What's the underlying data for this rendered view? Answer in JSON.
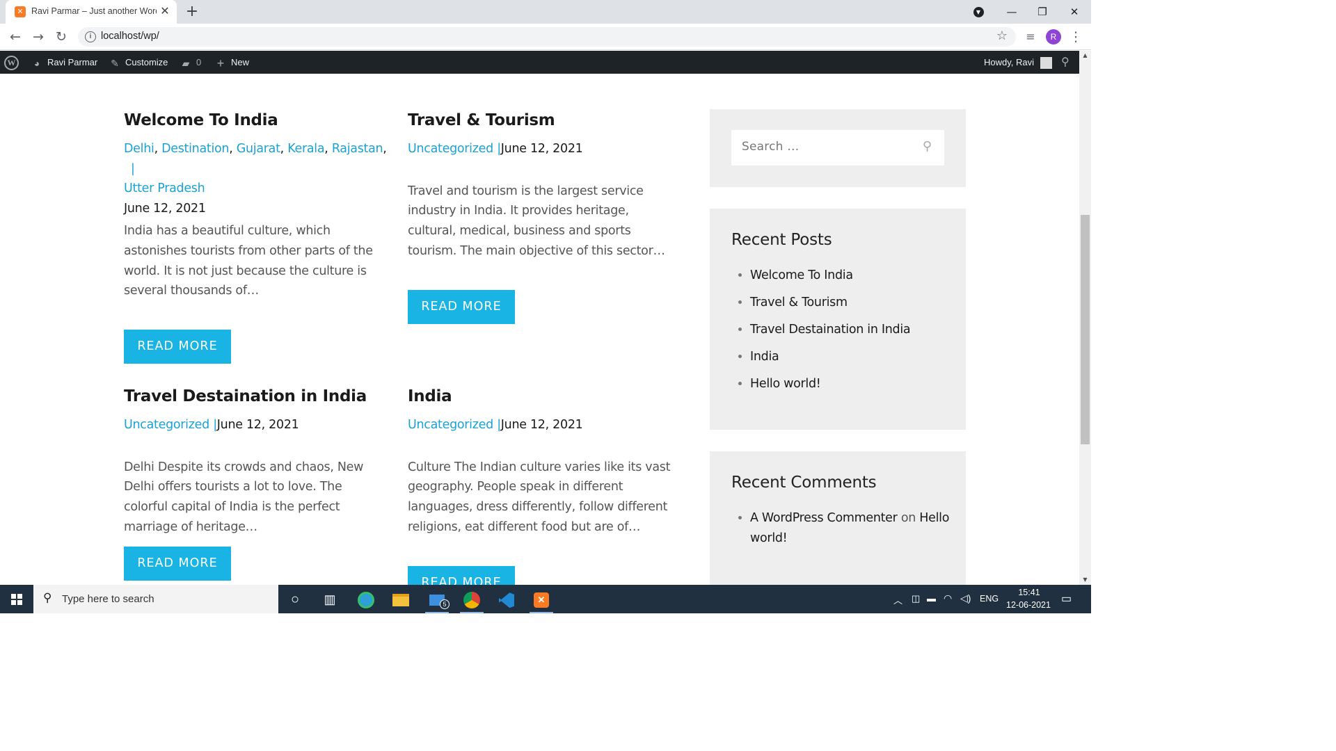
{
  "browser": {
    "tab_title": "Ravi Parmar – Just another Word",
    "tab_favicon_icon": "xampp-icon",
    "url": "localhost/wp/",
    "profile_initial": "R"
  },
  "admin_bar": {
    "site_name": "Ravi Parmar",
    "customize": "Customize",
    "comments_count": "0",
    "new": "New",
    "howdy": "Howdy, Ravi"
  },
  "posts": [
    {
      "title": "Welcome To India",
      "categories": [
        "Delhi",
        "Destination",
        "Gujarat",
        "Kerala",
        "Rajastan",
        "Utter Pradesh"
      ],
      "date": "June 12, 2021",
      "excerpt": "India has a beautiful culture, which astonishes tourists from other parts of the world. It is not just because the culture is several thousands of…",
      "button": "READ MORE"
    },
    {
      "title": "Travel & Tourism",
      "categories": [
        "Uncategorized"
      ],
      "date": "June 12, 2021",
      "excerpt": "Travel and tourism is the largest service industry in India. It provides heritage, cultural, medical, business and sports tourism. The main objective of this sector…",
      "button": "READ MORE"
    },
    {
      "title": "Travel Destaination in India",
      "categories": [
        "Uncategorized"
      ],
      "date": "June 12, 2021",
      "excerpt": "Delhi Despite its crowds and chaos, New Delhi offers tourists a lot to love. The colorful capital of India is the perfect marriage of heritage…",
      "button": "READ MORE"
    },
    {
      "title": "India",
      "categories": [
        "Uncategorized"
      ],
      "date": "June 12, 2021",
      "excerpt": "Culture The Indian culture varies like its vast geography. People speak in different languages, dress differently, follow different religions, eat different food but are of…",
      "button": "READ MORE"
    }
  ],
  "sidebar": {
    "search_placeholder": "Search …",
    "recent_posts_title": "Recent Posts",
    "recent_posts": [
      "Welcome To India",
      "Travel & Tourism",
      "Travel Destaination in India",
      "India",
      "Hello world!"
    ],
    "recent_comments_title": "Recent Comments",
    "comment_author": "A WordPress Commenter",
    "comment_on": "on",
    "comment_post": "Hello world!"
  },
  "taskbar": {
    "search_text": "Type here to search",
    "mail_badge": "5",
    "language": "ENG",
    "time": "15:41",
    "date": "12-06-2021"
  },
  "colors": {
    "accent": "#1ab4e4",
    "link": "#1aa2d4",
    "admin_bar": "#1d2327",
    "taskbar": "#203041"
  }
}
